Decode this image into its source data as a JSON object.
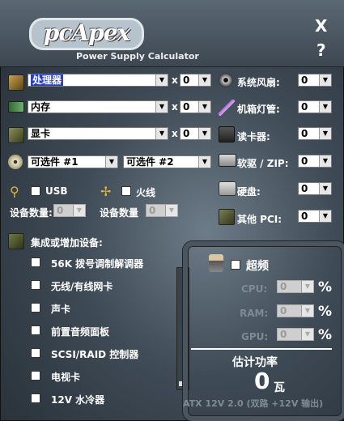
{
  "header": {
    "logo": "pcApex",
    "tagline": "Power Supply Calculator",
    "close_label": "X",
    "help_label": "?"
  },
  "left": {
    "cpu": {
      "value": "处理器",
      "qty": "0",
      "x": "x"
    },
    "ram": {
      "value": "内存",
      "qty": "0",
      "x": "x"
    },
    "gpu": {
      "value": "显卡",
      "qty": "0",
      "x": "x"
    },
    "optional1": "可选件 #1",
    "optional2": "可选件 #2",
    "usb_label": "USB",
    "firewire_label": "火线",
    "device_count_label": "设备数量:",
    "device_count_label2": "设备数量",
    "usb_count": "0",
    "firewire_count": "0"
  },
  "right": {
    "fans": {
      "label": "系统风扇:",
      "value": "0"
    },
    "lights": {
      "label": "机箱灯管:",
      "value": "0"
    },
    "cardreader": {
      "label": "读卡器:",
      "value": "0"
    },
    "floppy": {
      "label": "软驱 / ZIP:",
      "value": "0"
    },
    "hdd": {
      "label": "硬盘:",
      "value": "0"
    },
    "pci": {
      "label": "其他 PCI:",
      "value": "0"
    }
  },
  "integrated": {
    "title": "集成或增加设备:",
    "items": [
      "56K 拨号调制解调器",
      "无线/有线网卡",
      "声卡",
      "前置音频面板",
      "SCSI/RAID 控制器",
      "电视卡",
      "12V 水冷器"
    ]
  },
  "overclock": {
    "label": "超频",
    "cpu_label": "CPU:",
    "ram_label": "RAM:",
    "gpu_label": "GPU:",
    "cpu_value": "0",
    "ram_value": "0",
    "gpu_value": "0",
    "percent": "%"
  },
  "result": {
    "title": "估计功率",
    "value": "0",
    "unit": "瓦",
    "footer": "ATX 12V 2.0 (双路 +12V 输出)"
  },
  "colors": {
    "accent_select": "#2640c8",
    "background": "#3e4a55"
  }
}
